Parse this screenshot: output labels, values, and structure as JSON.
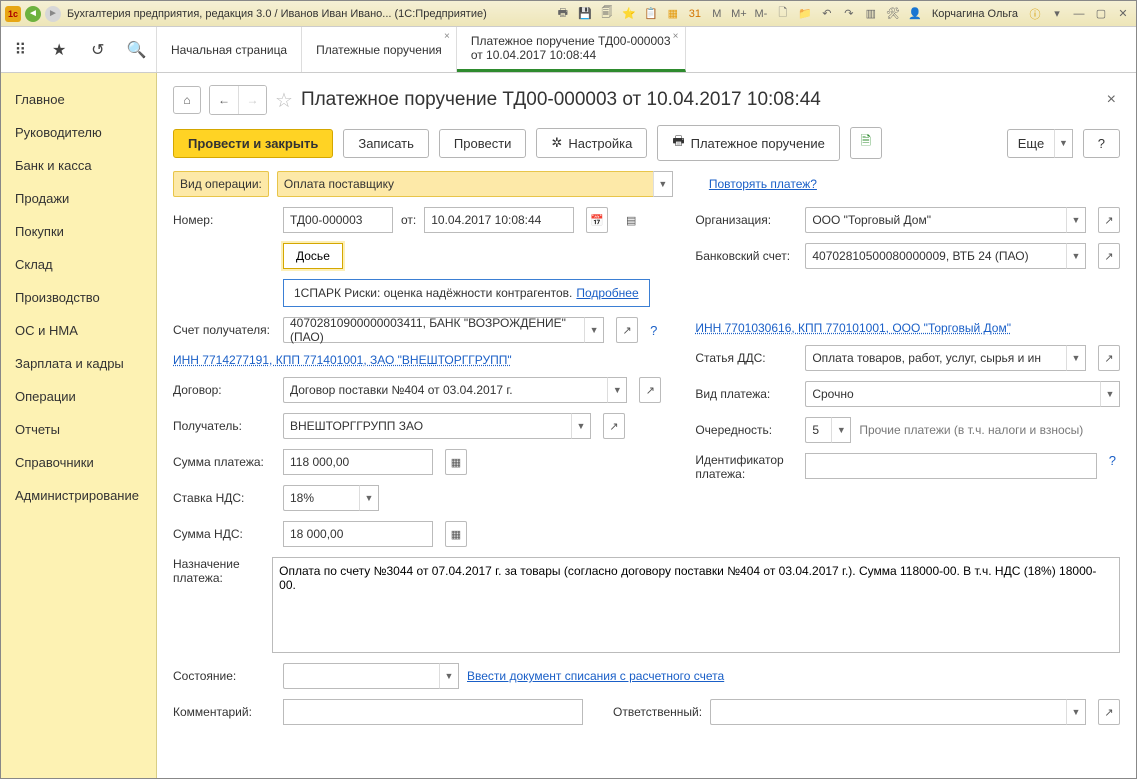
{
  "app": {
    "title": "Бухгалтерия предприятия, редакция 3.0 / Иванов Иван Ивано...  (1С:Предприятие)",
    "user": "Корчагина Ольга"
  },
  "toolbar_letters": {
    "m1": "M",
    "m2": "M+",
    "m3": "M-"
  },
  "tabs": [
    {
      "label": "Начальная страница"
    },
    {
      "label": "Платежные поручения"
    },
    {
      "label_line1": "Платежное поручение ТД00-000003",
      "label_line2": "от 10.04.2017 10:08:44"
    }
  ],
  "sidebar": {
    "items": [
      "Главное",
      "Руководителю",
      "Банк и касса",
      "Продажи",
      "Покупки",
      "Склад",
      "Производство",
      "ОС и НМА",
      "Зарплата и кадры",
      "Операции",
      "Отчеты",
      "Справочники",
      "Администрирование"
    ]
  },
  "form": {
    "title": "Платежное поручение ТД00-000003 от 10.04.2017 10:08:44",
    "buttons": {
      "post_close": "Провести и закрыть",
      "save": "Записать",
      "post": "Провести",
      "setup": "Настройка",
      "print": "Платежное поручение",
      "more": "Еще",
      "help": "?"
    },
    "op_label": "Вид операции:",
    "op_value": "Оплата поставщику",
    "repeat_link": "Повторять платеж?",
    "number_label": "Номер:",
    "number": "ТД00-000003",
    "from_label": "от:",
    "date": "10.04.2017 10:08:44",
    "dossier": "Досье",
    "spark_text": "1СПАРК Риски: оценка надёжности контрагентов.",
    "spark_link": "Подробнее",
    "recipient_acc_label": "Счет получателя:",
    "recipient_acc": "40702810900000003411, БАНК \"ВОЗРОЖДЕНИЕ\" (ПАО)",
    "inn_link": "ИНН 7714277191, КПП 771401001, ЗАО \"ВНЕШТОРГГРУПП\"",
    "contract_label": "Договор:",
    "contract": "Договор поставки №404 от 03.04.2017 г.",
    "recipient_label": "Получатель:",
    "recipient": "ВНЕШТОРГГРУПП ЗАО",
    "amount_label": "Сумма платежа:",
    "amount": "118 000,00",
    "vat_rate_label": "Ставка НДС:",
    "vat_rate": "18%",
    "vat_sum_label": "Сумма НДС:",
    "vat_sum": "18 000,00",
    "purpose_label": "Назначение платежа:",
    "purpose": "Оплата по счету №3044 от 07.04.2017 г. за товары (согласно договору поставки №404 от 03.04.2017 г.). Сумма 118000-00. В т.ч. НДС (18%) 18000-00.",
    "state_label": "Состояние:",
    "state_link": "Ввести документ списания с расчетного счета",
    "comment_label": "Комментарий:",
    "responsible_label": "Ответственный:",
    "org_label": "Организация:",
    "org": "ООО \"Торговый Дом\"",
    "bank_acc_label": "Банковский счет:",
    "bank_acc": "40702810500080000009, ВТБ 24 (ПАО)",
    "org_inn_link": "ИНН 7701030616, КПП 770101001, ООО \"Торговый Дом\"",
    "dds_label": "Статья ДДС:",
    "dds": "Оплата товаров, работ, услуг, сырья и ин",
    "payment_kind_label": "Вид платежа:",
    "payment_kind": "Срочно",
    "priority_label": "Очередность:",
    "priority": "5",
    "priority_note": "Прочие платежи (в т.ч. налоги и взносы)",
    "pay_id_label": "Идентификатор платежа:"
  }
}
